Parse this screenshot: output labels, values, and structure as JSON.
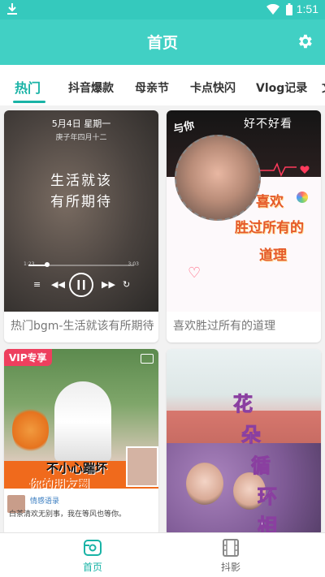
{
  "status_bar": {
    "time": "1:51",
    "download_icon": "download-icon",
    "wifi_icon": "wifi-icon",
    "battery_icon": "battery-icon"
  },
  "app_bar": {
    "title": "首页",
    "settings_icon": "gear-icon"
  },
  "tabs": [
    {
      "label": "热门",
      "active": true
    },
    {
      "label": "抖音爆款",
      "active": false
    },
    {
      "label": "母亲节",
      "active": false
    },
    {
      "label": "卡点快闪",
      "active": false
    },
    {
      "label": "Vlog记录",
      "active": false
    },
    {
      "label": "文",
      "active": false
    }
  ],
  "cards": [
    {
      "caption": "热门bgm-生活就该有所期待",
      "overlay": {
        "date": "5月4日 星期一",
        "lunar": "庚子年四月十二",
        "line1": "生活就该",
        "line2": "有所期待",
        "time_start": "1:23",
        "time_end": "3:03",
        "progress": 0.18
      }
    },
    {
      "caption": "喜欢胜过所有的道理",
      "overlay": {
        "header": "好不好看",
        "header_left": "与你",
        "line1": "喜欢",
        "line2": "胜过所有的",
        "line3": "道理"
      }
    },
    {
      "caption": "",
      "overlay": {
        "vip": "VIP专享",
        "line1": "不小心踹坏",
        "line2": "你的朋友圈",
        "post_title": "情感语录",
        "post_body": "白茶清欢无别事，我在等风也等你。"
      }
    },
    {
      "caption": "",
      "overlay": {
        "chars": [
          "花",
          "朵",
          "循",
          "环",
          "相"
        ]
      }
    }
  ],
  "bottom_nav": [
    {
      "label": "首页",
      "icon": "home-icon",
      "active": true
    },
    {
      "label": "抖影",
      "icon": "film-icon",
      "active": false
    }
  ],
  "colors": {
    "accent": "#19b3a6",
    "appbar": "#41d0c4",
    "statusbar": "#35c9bd"
  }
}
